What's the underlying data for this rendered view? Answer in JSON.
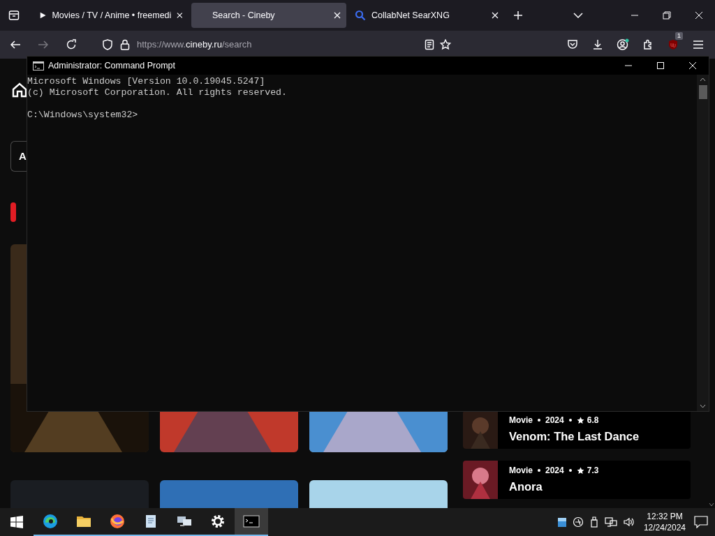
{
  "browser": {
    "tabs": [
      {
        "label": "Movies / TV / Anime • freemedi",
        "selected": false,
        "kind": "playing"
      },
      {
        "label": "Search - Cineby",
        "selected": true,
        "kind": "page"
      },
      {
        "label": "CollabNet SearXNG",
        "selected": false,
        "kind": "search"
      }
    ],
    "url": {
      "prefix": "https://www.",
      "domain": "cineby.ru",
      "path": "/search"
    },
    "extension_badge": "1"
  },
  "page": {
    "search": {
      "value": "A"
    },
    "list": [
      {
        "type": "Movie",
        "year": "2024",
        "rating": "6.8",
        "title": "Venom: The Last Dance"
      },
      {
        "type": "Movie",
        "year": "2024",
        "rating": "7.3",
        "title": "Anora"
      }
    ]
  },
  "console": {
    "title": "Administrator: Command Prompt",
    "blocks": [
      [
        "Microsoft Windows [Version 10.0.19045.5247]",
        "(c) Microsoft Corporation. All rights reserved."
      ],
      [
        "C:\\Windows\\system32>"
      ]
    ]
  },
  "taskbar": {
    "apps": [
      {
        "kind": "edge",
        "active": false
      },
      {
        "kind": "folder",
        "active": false
      },
      {
        "kind": "firefox",
        "active": false
      },
      {
        "kind": "notepad",
        "active": false
      },
      {
        "kind": "monitors",
        "active": false
      },
      {
        "kind": "settings",
        "active": false
      },
      {
        "kind": "terminal",
        "active": true
      }
    ],
    "time": "12:32 PM",
    "date": "12/24/2024"
  }
}
